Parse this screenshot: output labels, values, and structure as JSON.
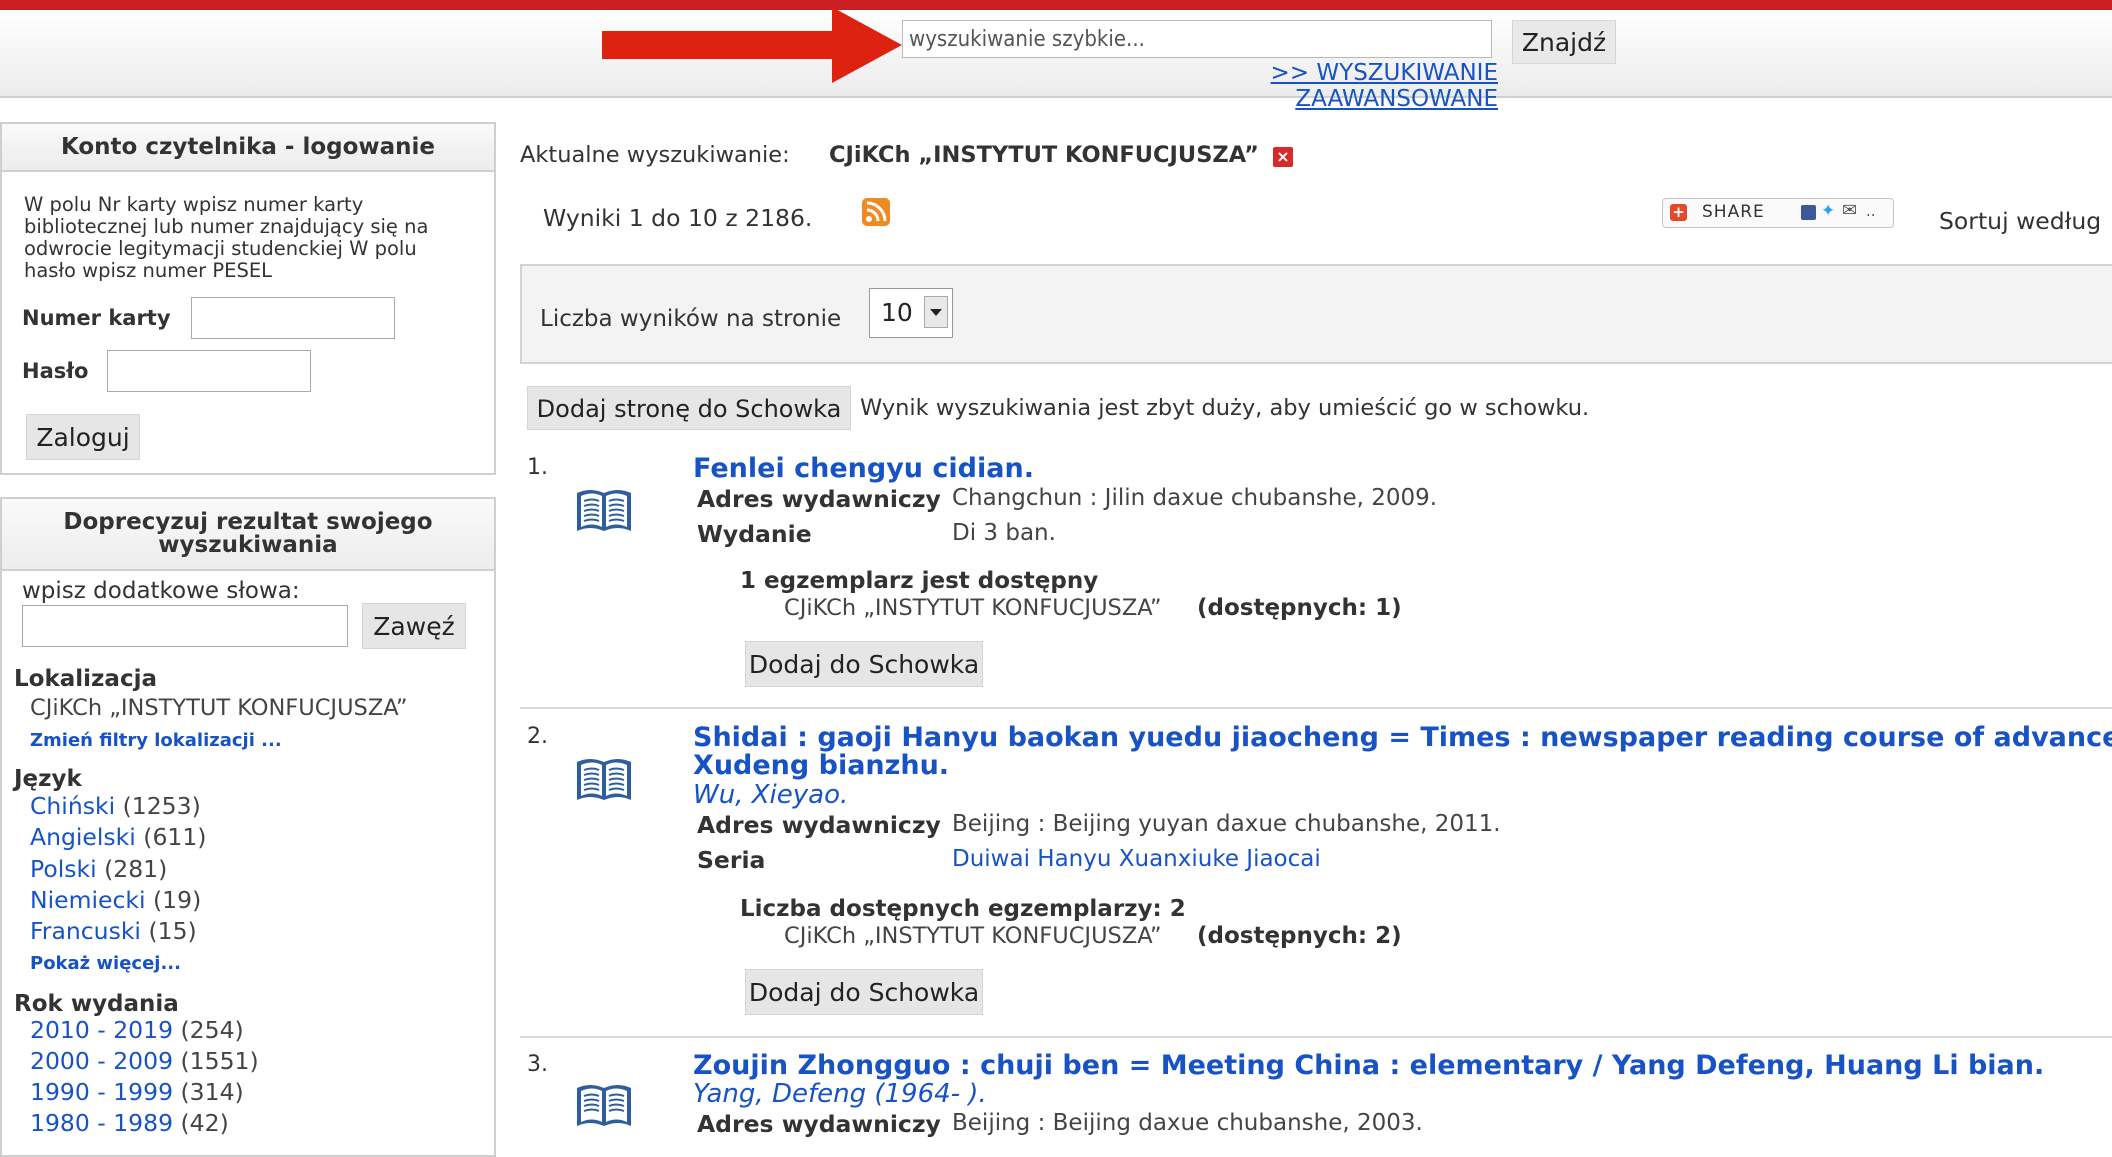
{
  "header": {
    "search_placeholder": "wyszukiwanie szybkie...",
    "find_button": "Znajdź",
    "advanced_link": ">> WYSZUKIWANIE ZAAWANSOWANE",
    "accent_color": "#cc1f24"
  },
  "login": {
    "title": "Konto czytelnika - logowanie",
    "info": "W polu Nr karty wpisz numer karty bibliotecznej lub numer znajdujący się na odwrocie legitymacji studenckiej W polu hasło wpisz numer PESEL",
    "card_label": "Numer karty",
    "card_value": "",
    "password_label": "Hasło",
    "password_value": "",
    "login_button": "Zaloguj"
  },
  "refine": {
    "title": "Doprecyzuj rezultat swojego wyszukiwania",
    "words_label": "wpisz dodatkowe słowa:",
    "words_value": "",
    "narrow_button": "Zawęź",
    "location": {
      "heading": "Lokalizacja",
      "value": "CJiKCh „INSTYTUT KONFUCJUSZA”",
      "change_link": "Zmień filtry lokalizacji ..."
    },
    "language": {
      "heading": "Język",
      "items": [
        {
          "name": "Chiński",
          "count": "(1253)"
        },
        {
          "name": "Angielski",
          "count": "(611)"
        },
        {
          "name": "Polski",
          "count": "(281)"
        },
        {
          "name": "Niemiecki",
          "count": "(19)"
        },
        {
          "name": "Francuski",
          "count": "(15)"
        }
      ],
      "more_link": "Pokaż więcej..."
    },
    "year": {
      "heading": "Rok wydania",
      "items": [
        {
          "name": "2010 - 2019",
          "count": "(254)"
        },
        {
          "name": "2000 - 2009",
          "count": "(1551)"
        },
        {
          "name": "1990 - 1999",
          "count": "(314)"
        },
        {
          "name": "1980 - 1989",
          "count": "(42)"
        }
      ]
    }
  },
  "search": {
    "current_label": "Aktualne wyszukiwanie:",
    "current_term": "CJiKCh „INSTYTUT KONFUCJUSZA”",
    "results_count": "Wyniki 1 do 10 z 2186.",
    "share_label": "SHARE",
    "sort_label": "Sortuj według",
    "per_page_label": "Liczba wyników na stronie",
    "per_page_value": "10",
    "add_page_button": "Dodaj stronę do Schowka",
    "clipboard_note": "Wynik wyszukiwania jest zbyt duży, aby umieścić go w schowku."
  },
  "results": [
    {
      "number": "1.",
      "title_line1": "Fenlei chengyu cidian.",
      "fields": [
        {
          "key": "Adres wydawniczy",
          "value": "Changchun : Jilin daxue chubanshe, 2009."
        },
        {
          "key": "Wydanie",
          "value": "Di 3 ban."
        }
      ],
      "availability": "1 egzemplarz jest dostępny",
      "location": "CJiKCh „INSTYTUT KONFUCJUSZA”",
      "available_count": "(dostępnych: 1)",
      "button": "Dodaj do Schowka"
    },
    {
      "number": "2.",
      "title_line1": "Shidai : gaoji Hanyu baokan yuedu jiaocheng = Times : newspaper reading course of advanced Chi",
      "title_line2": "Xudeng bianzhu.",
      "author": "Wu, Xieyao.",
      "fields": [
        {
          "key": "Adres wydawniczy",
          "value": "Beijing : Beijing yuyan daxue chubanshe, 2011."
        },
        {
          "key": "Seria",
          "value": "Duiwai Hanyu Xuanxiuke Jiaocai"
        }
      ],
      "availability": "Liczba dostępnych egzemplarzy: 2",
      "location": "CJiKCh „INSTYTUT KONFUCJUSZA”",
      "available_count": "(dostępnych: 2)",
      "button": "Dodaj do Schowka"
    },
    {
      "number": "3.",
      "title_line1": "Zoujin Zhongguo : chuji ben = Meeting China : elementary / Yang Defeng, Huang Li bian.",
      "author": "Yang, Defeng (1964- ).",
      "fields": [
        {
          "key": "Adres wydawniczy",
          "value": "Beijing : Beijing daxue chubanshe, 2003."
        }
      ]
    }
  ]
}
